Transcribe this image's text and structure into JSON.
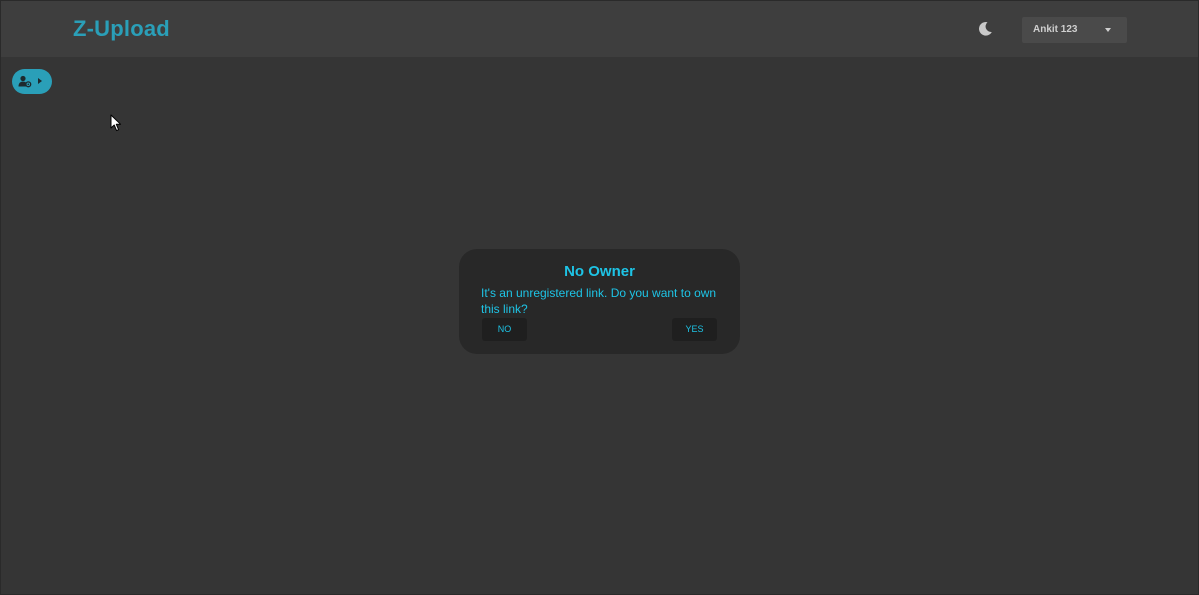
{
  "header": {
    "app_title": "Z-Upload",
    "user_menu": {
      "username": "Ankit 123"
    }
  },
  "icons": {
    "theme_toggle": "moon-icon",
    "user_menu_caret": "caret-down-icon",
    "pill_people": "people-settings-icon",
    "pill_arrow": "caret-right-icon",
    "cursor": "mouse-pointer-icon"
  },
  "dialog": {
    "title": "No Owner",
    "message": "It's an unregistered link. Do you want to own this link?",
    "buttons": {
      "no": "NO",
      "yes": "YES"
    }
  },
  "colors": {
    "accent": "#2a9fb8",
    "dialog_text": "#1ec4e6",
    "background": "#353535",
    "header_bg": "#3e3e3e",
    "dialog_bg": "#282828"
  }
}
